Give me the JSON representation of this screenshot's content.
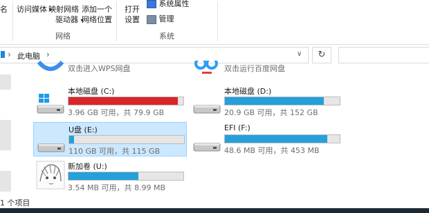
{
  "ribbon": {
    "btn_open": "名",
    "btn_access_media": "访问媒体",
    "btn_map_drive_1": "映射网络",
    "btn_map_drive_2": "驱动器",
    "btn_add_location_1": "添加一个",
    "btn_add_location_2": "网络位置",
    "group_network": "网络",
    "btn_open_settings_1": "打开",
    "btn_open_settings_2": "设置",
    "btn_sys_props": "系统属性",
    "btn_manage": "管理",
    "group_system": "系统"
  },
  "address": {
    "path": "此电脑",
    "chevron": "›"
  },
  "cloud": {
    "wps_label": "双击进入WPS网盘",
    "baidu_label": "双击运行百度网盘"
  },
  "drives": [
    {
      "name": "本地磁盘 (C:)",
      "info": "3.96 GB 可用，共 79.9 GB",
      "used_fraction": 0.95,
      "color": "#da2626"
    },
    {
      "name": "本地磁盘 (D:)",
      "info": "20.9 GB 可用，共 152 GB",
      "used_fraction": 0.86,
      "color": "#26a0da"
    },
    {
      "name": "U盘 (E:)",
      "info": "110 GB 可用，共 115 GB",
      "used_fraction": 0.04,
      "color": "#26a0da"
    },
    {
      "name": "EFI (F:)",
      "info": "48.6 MB 可用，共 453 MB",
      "used_fraction": 0.89,
      "color": "#26a0da"
    },
    {
      "name": "新加卷 (U:)",
      "info": "3.54 MB 可用，共 8.99 MB",
      "used_fraction": 0.61,
      "color": "#26a0da"
    }
  ],
  "status": {
    "count": "1 个项目"
  }
}
